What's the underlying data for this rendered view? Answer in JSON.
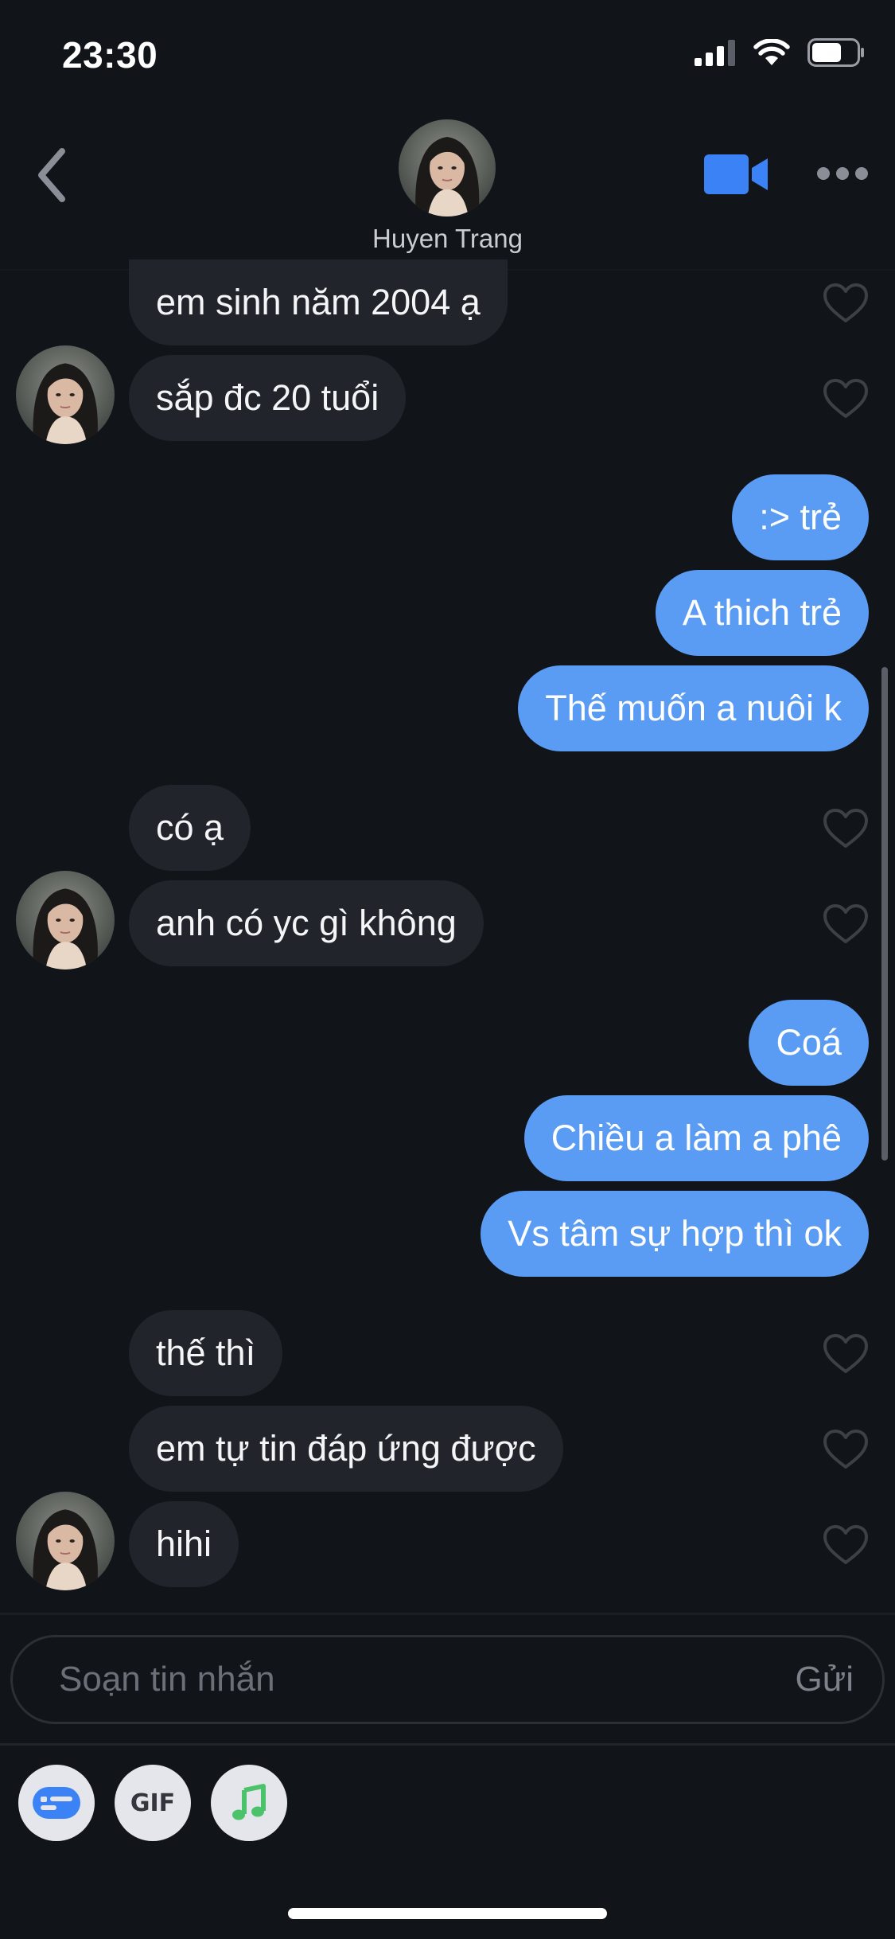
{
  "status_bar": {
    "time": "23:30",
    "battery_level": 0.6
  },
  "header": {
    "contact_name": "Huyen Trang",
    "back_icon": "chevron-left-icon",
    "video_icon": "video-camera-icon",
    "more_icon": "more-horizontal-icon"
  },
  "messages": {
    "m1": "em sinh năm 2004 ạ",
    "m2": "sắp đc 20 tuổi",
    "m3": ":> trẻ",
    "m4": "A thich trẻ",
    "m5": "Thế muốn a nuôi k",
    "m6": "có ạ",
    "m7": "anh có yc gì không",
    "m8": "Coá",
    "m9": "Chiều a làm a phê",
    "m10": "Vs tâm sự hợp thì ok",
    "m11": "thế thì",
    "m12": "em tự tin đáp ứng được",
    "m13": "hihi"
  },
  "composer": {
    "placeholder": "Soạn tin nhắn",
    "send_label": "Gửi"
  },
  "toolbar": {
    "gif_label": "GIF",
    "sticker_icon": "sticker-card-icon",
    "music_icon": "music-note-icon"
  },
  "colors": {
    "background": "#111418",
    "incoming_bubble": "#21252b",
    "outgoing_bubble": "#5a9bf4",
    "accent": "#3b82f6"
  }
}
